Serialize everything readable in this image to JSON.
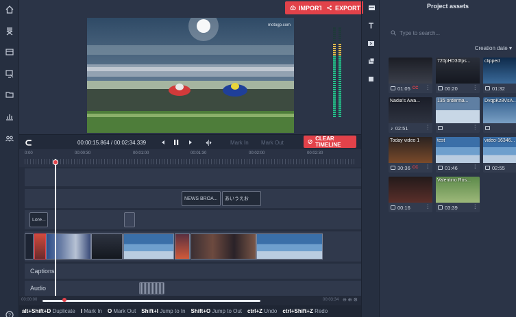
{
  "toolbar": {
    "import_label": "IMPORT",
    "export_label": "EXPORT",
    "clear_label": "CLEAR TIMELINE"
  },
  "player": {
    "time": "00:00:15.864 / 00:02:34.339",
    "mark_in": "Mark In",
    "mark_out": "Mark Out"
  },
  "ruler": {
    "labels": [
      "0:00",
      "00:00:30",
      "00:01:00",
      "00:01:30",
      "00:02:00",
      "00:02:30"
    ]
  },
  "timeline": {
    "clips": {
      "news": "NEWS BROA...",
      "jp": "あいうえお",
      "lorem": "Lore..."
    },
    "captions_label": "Captions",
    "audio_label": "Audio",
    "scroll_start": "00:00:00",
    "scroll_end": "00:03:34"
  },
  "shortcuts": [
    {
      "key": "alt+Shift+D",
      "label": "Duplicate"
    },
    {
      "key": "I",
      "label": "Mark In"
    },
    {
      "key": "O",
      "label": "Mark Out"
    },
    {
      "key": "Shift+I",
      "label": "Jump to In"
    },
    {
      "key": "Shift+O",
      "label": "Jump to Out"
    },
    {
      "key": "ctrl+Z",
      "label": "Undo"
    },
    {
      "key": "ctrl+Shift+Z",
      "label": "Redo"
    }
  ],
  "assets": {
    "title": "Project assets",
    "search_placeholder": "Type to search...",
    "sort_label": "Creation date",
    "items": [
      {
        "name": "",
        "duration": "01:05",
        "cc": "CC",
        "kind": "video"
      },
      {
        "name": "720pHD30fps...",
        "duration": "00:20",
        "cc": "",
        "kind": "video"
      },
      {
        "name": "clipped",
        "duration": "01:32",
        "cc": "",
        "kind": "video"
      },
      {
        "name": "Nadia's Awa...",
        "duration": "02:51",
        "cc": "",
        "kind": "audio"
      },
      {
        "name": "135 orderma...",
        "duration": "",
        "cc": "",
        "kind": "image"
      },
      {
        "name": "DvqpKz8VsA...",
        "duration": "",
        "cc": "",
        "kind": "image"
      },
      {
        "name": "Today video 1",
        "duration": "30:36",
        "cc": "CC",
        "kind": "video"
      },
      {
        "name": "test",
        "duration": "01:46",
        "cc": "",
        "kind": "video"
      },
      {
        "name": "video-16346...",
        "duration": "02:55",
        "cc": "",
        "kind": "video"
      },
      {
        "name": "",
        "duration": "00:16",
        "cc": "",
        "kind": "video"
      },
      {
        "name": "Valentino Ros...",
        "duration": "03:39",
        "cc": "",
        "kind": "video"
      }
    ]
  },
  "colors": {
    "accent": "#e2424a",
    "panel": "#2b3447",
    "dark": "#262f40"
  }
}
